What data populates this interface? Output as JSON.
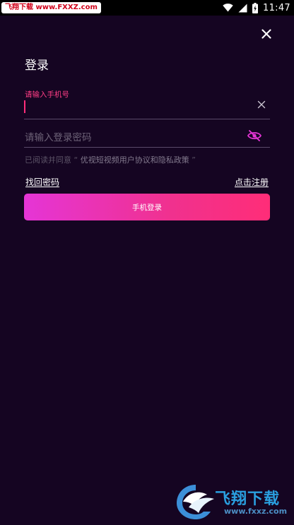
{
  "status_bar": {
    "watermark_text": "飞翔下载 www.FXXZ.com",
    "time": "11:47",
    "icons": [
      "wifi-icon",
      "signal-icon",
      "battery-charging-icon"
    ]
  },
  "header": {
    "title": "登录",
    "close_icon": "close-icon"
  },
  "phone": {
    "label": "请输入手机号",
    "value": "",
    "clear_icon": "clear-icon"
  },
  "password": {
    "placeholder": "请输入登录密码",
    "visibility_icon": "eye-off-icon"
  },
  "agreement": {
    "prefix": "已阅读并同意 “ ",
    "link": "优视短视频用户协议和隐私政策",
    "suffix": " ”"
  },
  "links": {
    "forgot": "找回密码",
    "register": "点击注册"
  },
  "login_button": {
    "label": "手机登录"
  },
  "watermark": {
    "brand": "飞翔下载",
    "url": "www.fxxz.com"
  },
  "colors": {
    "background": "#150522",
    "accent_pink": "#ff2d7a",
    "accent_magenta": "#e535d6",
    "eye_icon": "#e535d6"
  }
}
